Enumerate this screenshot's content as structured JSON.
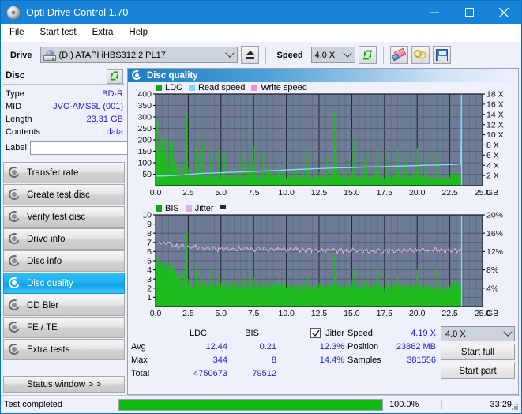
{
  "window": {
    "title": "Opti Drive Control 1.70",
    "icon": "disc-icon",
    "minimize": "minimize-icon",
    "maximize": "maximize-icon",
    "close": "close-icon"
  },
  "menu": {
    "items": [
      "File",
      "Start test",
      "Extra",
      "Help"
    ]
  },
  "toolbar": {
    "drive_label": "Drive",
    "drive_value": "(D:)  ATAPI iHBS312  2 PL17",
    "eject_icon": "eject-icon",
    "speed_label": "Speed",
    "speed_value": "4.0 X",
    "refresh_icon": "refresh-icon",
    "eraser_icon": "eraser-icon",
    "gold_icon": "rings-icon",
    "save_icon": "save-icon"
  },
  "disc": {
    "header": "Disc",
    "refresh_icon": "refresh-icon",
    "rows": [
      {
        "key": "Type",
        "value": "BD-R"
      },
      {
        "key": "MID",
        "value": "JVC-AMS6L (001)"
      },
      {
        "key": "Length",
        "value": "23.31 GB"
      },
      {
        "key": "Contents",
        "value": "data"
      }
    ],
    "label_key": "Label",
    "label_value": "",
    "label_placeholder": "",
    "cd_icon": "disc-icon"
  },
  "nav": {
    "items": [
      {
        "label": "Transfer rate",
        "active": false
      },
      {
        "label": "Create test disc",
        "active": false
      },
      {
        "label": "Verify test disc",
        "active": false
      },
      {
        "label": "Drive info",
        "active": false
      },
      {
        "label": "Disc info",
        "active": false
      },
      {
        "label": "Disc quality",
        "active": true
      },
      {
        "label": "CD Bler",
        "active": false
      },
      {
        "label": "FE / TE",
        "active": false
      },
      {
        "label": "Extra tests",
        "active": false
      }
    ],
    "status_window": "Status window > >"
  },
  "panel": {
    "title": "Disc quality",
    "icon": "disc-icon"
  },
  "stats": {
    "col_headers": [
      "",
      "LDC",
      "BIS",
      "Jitter"
    ],
    "jitter_checked": true,
    "jitter_label": "Jitter",
    "rows": [
      {
        "name": "Avg",
        "ldc": "12.44",
        "bis": "0.21",
        "jitter": "12.3%"
      },
      {
        "name": "Max",
        "ldc": "344",
        "bis": "8",
        "jitter": "14.4%"
      },
      {
        "name": "Total",
        "ldc": "4750673",
        "bis": "79512",
        "jitter": ""
      }
    ],
    "info": [
      {
        "key": "Speed",
        "value": "4.19 X"
      },
      {
        "key": "Position",
        "value": "23862 MB"
      },
      {
        "key": "Samples",
        "value": "381556"
      }
    ],
    "speed_select": "4.0 X",
    "start_full": "Start full",
    "start_part": "Start part"
  },
  "statusbar": {
    "text": "Test completed",
    "percent_label": "100.0%",
    "percent_value": 100,
    "time": "33:29"
  },
  "colors": {
    "ldc": "#0fa80f",
    "bis": "#0fa80f",
    "read_speed": "#86d5f3",
    "write_speed": "#ff8ad8",
    "jitter": "#e3aee6",
    "plot_bg": "#6f7c96",
    "accent": "#1683d8",
    "value_blue": "#2121d0"
  },
  "chart_data": [
    {
      "type": "line",
      "title": "LDC / Read speed",
      "xlabel": "GB",
      "ylabel": "LDC",
      "xlim": [
        0,
        25
      ],
      "xticks": [
        "0.0",
        "2.5",
        "5.0",
        "7.5",
        "10.0",
        "12.5",
        "15.0",
        "17.5",
        "20.0",
        "22.5",
        "25.0"
      ],
      "ylim": [
        0,
        400
      ],
      "yticks": [
        50,
        100,
        150,
        200,
        250,
        300,
        350,
        400
      ],
      "y2label": "X",
      "y2lim": [
        0,
        18
      ],
      "y2ticks": [
        "2 X",
        "4 X",
        "6 X",
        "8 X",
        "10 X",
        "12 X",
        "14 X",
        "16 X",
        "18 X"
      ],
      "grid": true,
      "legend": [
        {
          "name": "LDC",
          "color": "#0fa80f"
        },
        {
          "name": "Read speed",
          "color": "#86d5f3"
        },
        {
          "name": "Write speed",
          "color": "#ff8ad8"
        }
      ],
      "data_end_gb": 23.4,
      "series": [
        {
          "name": "LDC",
          "kind": "area-spikes",
          "x": [
            0.0,
            0.1,
            0.2,
            0.3,
            0.4,
            0.5,
            0.6,
            0.7,
            0.8,
            0.9,
            1.0,
            1.1,
            1.2,
            1.3,
            1.4,
            1.5,
            1.6,
            1.7,
            1.8,
            1.9,
            2.0,
            2.2,
            2.4,
            2.55,
            2.7,
            2.9,
            3.1,
            3.3,
            3.55,
            3.75,
            3.95,
            4.15,
            4.35,
            4.55,
            4.8,
            5.0,
            5.25,
            5.45,
            5.7,
            5.95,
            6.2,
            6.45,
            6.7,
            6.95,
            7.2,
            7.45,
            7.55,
            7.7,
            7.95,
            8.2,
            8.45,
            8.7,
            8.95,
            9.2,
            9.45,
            9.7,
            9.85,
            10.1,
            10.4,
            10.7,
            11.0,
            11.3,
            11.6,
            11.9,
            12.2,
            12.5,
            12.8,
            13.1,
            13.4,
            13.7,
            14.0,
            14.3,
            14.6,
            14.9,
            15.0,
            15.2,
            15.5,
            15.8,
            16.1,
            16.4,
            16.7,
            17.0,
            17.3,
            17.6,
            17.9,
            18.2,
            18.5,
            18.8,
            19.1,
            19.4,
            19.7,
            20.0,
            20.3,
            20.6,
            20.9,
            21.2,
            21.5,
            21.8,
            22.1,
            22.4,
            22.7,
            23.0,
            23.2,
            23.4
          ],
          "values": [
            120,
            285,
            160,
            200,
            150,
            215,
            130,
            205,
            95,
            210,
            110,
            190,
            80,
            195,
            70,
            185,
            75,
            150,
            60,
            120,
            55,
            70,
            305,
            60,
            50,
            45,
            165,
            55,
            230,
            48,
            60,
            160,
            55,
            50,
            150,
            45,
            140,
            50,
            60,
            55,
            50,
            160,
            45,
            90,
            345,
            70,
            170,
            60,
            50,
            140,
            45,
            295,
            50,
            45,
            140,
            40,
            55,
            120,
            45,
            150,
            45,
            100,
            155,
            40,
            95,
            60,
            45,
            130,
            40,
            325,
            55,
            45,
            110,
            50,
            60,
            205,
            45,
            60,
            150,
            40,
            55,
            165,
            45,
            150,
            50,
            70,
            160,
            45,
            150,
            40,
            60,
            165,
            45,
            130,
            50,
            60,
            145,
            40,
            120,
            55,
            60,
            70,
            60,
            55
          ]
        },
        {
          "name": "Read speed",
          "kind": "line",
          "axis": "right",
          "x": [
            0.0,
            0.5,
            1.0,
            1.5,
            2.0,
            2.5,
            3.0,
            3.5,
            4.0,
            4.5,
            5.0,
            5.5,
            6.0,
            6.5,
            7.0,
            7.5,
            8.0,
            8.5,
            9.0,
            9.5,
            10.0,
            10.5,
            11.0,
            11.5,
            12.0,
            12.5,
            13.0,
            13.5,
            14.0,
            14.5,
            15.0,
            15.5,
            16.0,
            16.5,
            17.0,
            17.5,
            18.0,
            18.5,
            19.0,
            19.5,
            20.0,
            20.5,
            21.0,
            21.5,
            22.0,
            22.5,
            23.0,
            23.35,
            23.4
          ],
          "values": [
            1.9,
            1.9,
            1.95,
            2.0,
            2.1,
            2.2,
            2.3,
            2.4,
            2.45,
            2.5,
            2.55,
            2.6,
            2.65,
            2.7,
            2.75,
            2.8,
            2.85,
            2.9,
            2.95,
            3.0,
            3.1,
            3.15,
            3.2,
            3.25,
            3.3,
            3.35,
            3.4,
            3.45,
            3.5,
            3.52,
            3.55,
            3.6,
            3.65,
            3.7,
            3.72,
            3.75,
            3.8,
            3.82,
            3.85,
            3.9,
            3.95,
            4.0,
            4.02,
            4.05,
            4.1,
            4.15,
            4.2,
            4.25,
            18.0
          ]
        }
      ]
    },
    {
      "type": "line",
      "title": "BIS / Jitter",
      "xlabel": "GB",
      "ylabel": "BIS",
      "xlim": [
        0,
        25
      ],
      "xticks": [
        "0.0",
        "2.5",
        "5.0",
        "7.5",
        "10.0",
        "12.5",
        "15.0",
        "17.5",
        "20.0",
        "22.5",
        "25.0"
      ],
      "ylim": [
        0,
        10
      ],
      "yticks": [
        1,
        2,
        3,
        4,
        5,
        6,
        7,
        8,
        9,
        10
      ],
      "y2label": "%",
      "y2lim": [
        0,
        20
      ],
      "y2ticks": [
        "4%",
        "8%",
        "12%",
        "16%",
        "20%"
      ],
      "grid": true,
      "legend": [
        {
          "name": "BIS",
          "color": "#0fa80f"
        },
        {
          "name": "Jitter",
          "color": "#e3aee6"
        }
      ],
      "data_end_gb": 23.4,
      "series": [
        {
          "name": "BIS",
          "kind": "area-spikes",
          "x": [
            0.0,
            0.1,
            0.2,
            0.3,
            0.4,
            0.5,
            0.6,
            0.7,
            0.8,
            0.9,
            1.0,
            1.1,
            1.2,
            1.3,
            1.4,
            1.5,
            1.6,
            1.7,
            1.8,
            1.9,
            2.0,
            2.2,
            2.4,
            2.55,
            2.7,
            2.9,
            3.1,
            3.3,
            3.55,
            3.75,
            3.95,
            4.15,
            4.35,
            4.55,
            4.8,
            5.0,
            5.25,
            5.45,
            5.7,
            5.95,
            6.2,
            6.45,
            6.7,
            6.95,
            7.2,
            7.45,
            7.55,
            7.7,
            7.95,
            8.2,
            8.45,
            8.7,
            8.95,
            9.2,
            9.45,
            9.7,
            9.85,
            10.1,
            10.4,
            10.7,
            11.0,
            11.3,
            11.6,
            11.9,
            12.2,
            12.5,
            12.8,
            13.1,
            13.4,
            13.7,
            14.0,
            14.3,
            14.6,
            14.9,
            15.0,
            15.2,
            15.5,
            15.8,
            16.1,
            16.4,
            16.7,
            17.0,
            17.3,
            17.6,
            17.9,
            18.2,
            18.5,
            18.8,
            19.1,
            19.4,
            19.7,
            20.0,
            20.3,
            20.6,
            20.9,
            21.2,
            21.5,
            21.8,
            22.1,
            22.4,
            22.7,
            23.0,
            23.2,
            23.4
          ],
          "values": [
            4.2,
            5.3,
            4.6,
            5.2,
            4.4,
            5.0,
            4.3,
            4.8,
            4.2,
            5.1,
            4.0,
            4.7,
            3.8,
            4.5,
            3.6,
            4.2,
            3.4,
            4.0,
            3.2,
            3.6,
            3.0,
            3.4,
            8.1,
            3.0,
            2.8,
            2.6,
            4.2,
            2.8,
            3.2,
            2.6,
            2.8,
            4.3,
            2.6,
            2.8,
            3.2,
            2.6,
            3.0,
            2.6,
            2.8,
            2.6,
            2.6,
            3.1,
            2.6,
            2.8,
            6.1,
            2.6,
            3.2,
            2.6,
            2.6,
            3.0,
            2.6,
            5.0,
            2.6,
            2.6,
            3.1,
            2.6,
            2.6,
            3.0,
            2.6,
            3.2,
            2.6,
            2.8,
            3.4,
            2.5,
            2.8,
            2.6,
            2.6,
            3.0,
            2.6,
            5.8,
            2.6,
            2.6,
            3.0,
            2.6,
            2.6,
            4.1,
            2.6,
            2.6,
            3.2,
            2.6,
            2.6,
            4.3,
            2.6,
            3.0,
            2.6,
            2.8,
            3.2,
            2.6,
            3.0,
            2.6,
            2.6,
            4.0,
            2.6,
            3.0,
            2.6,
            2.8,
            4.2,
            2.6,
            3.0,
            2.6,
            2.8,
            3.0,
            2.8,
            2.6
          ]
        },
        {
          "name": "Jitter",
          "kind": "line",
          "axis": "right",
          "x": [
            0.0,
            0.3,
            0.6,
            0.9,
            1.2,
            1.5,
            1.8,
            2.1,
            2.4,
            2.7,
            3.0,
            3.5,
            4.0,
            4.5,
            5.0,
            5.5,
            6.0,
            6.5,
            7.0,
            7.5,
            8.0,
            8.5,
            9.0,
            9.5,
            10.0,
            10.5,
            11.0,
            11.5,
            12.0,
            12.5,
            13.0,
            13.5,
            14.0,
            14.5,
            15.0,
            15.5,
            16.0,
            16.5,
            17.0,
            17.5,
            18.0,
            18.5,
            19.0,
            19.5,
            20.0,
            20.5,
            21.0,
            21.5,
            22.0,
            22.5,
            23.0,
            23.4
          ],
          "values": [
            13.6,
            14.0,
            13.8,
            14.0,
            13.6,
            13.2,
            13.0,
            13.2,
            13.0,
            12.9,
            13.0,
            12.8,
            12.6,
            12.7,
            12.5,
            12.6,
            12.5,
            12.7,
            12.6,
            12.5,
            12.6,
            12.4,
            12.5,
            12.6,
            12.4,
            12.5,
            12.4,
            12.3,
            12.4,
            12.3,
            12.2,
            12.3,
            12.2,
            12.1,
            12.3,
            12.1,
            12.2,
            12.1,
            12.2,
            12.1,
            12.2,
            12.1,
            12.2,
            12.1,
            12.2,
            12.3,
            12.2,
            12.3,
            12.2,
            12.3,
            12.2,
            12.2
          ]
        }
      ]
    }
  ]
}
